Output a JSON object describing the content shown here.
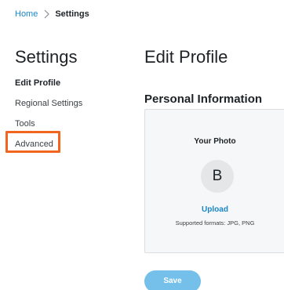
{
  "breadcrumb": {
    "home": "Home",
    "current": "Settings",
    "separator_icon": "chevron-right-icon"
  },
  "settings": {
    "title": "Settings",
    "items": [
      {
        "label": "Edit Profile",
        "active": true
      },
      {
        "label": "Regional Settings",
        "active": false
      },
      {
        "label": "Tools",
        "active": false
      },
      {
        "label": "Advanced",
        "active": false,
        "highlighted": true
      }
    ]
  },
  "main": {
    "title": "Edit Profile",
    "section_title": "Personal Information",
    "photo": {
      "label": "Your Photo",
      "initial": "B",
      "upload_label": "Upload",
      "formats": "Supported formats: JPG, PNG"
    },
    "save_label": "Save"
  },
  "colors": {
    "accent": "#1787c7",
    "save_button": "#74c0ea",
    "highlight_border": "#f2651e"
  }
}
